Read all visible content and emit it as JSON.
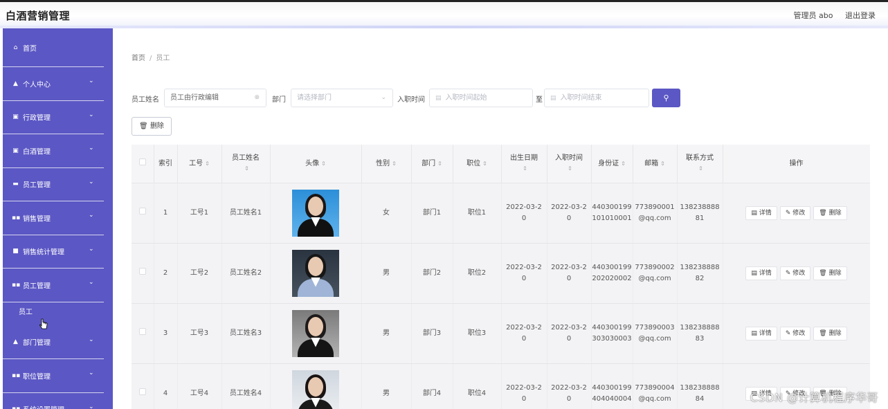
{
  "header": {
    "title": "白酒营销管理",
    "admin_label": "管理员 abo",
    "logout_label": "退出登录"
  },
  "sidebar": {
    "items": [
      {
        "label": "首页",
        "icon": "home-icon",
        "glyph": "⌂",
        "has_caret": false
      },
      {
        "label": "个人中心",
        "icon": "person-icon",
        "glyph": "▲",
        "has_caret": true
      },
      {
        "label": "行政管理",
        "icon": "building-icon",
        "glyph": "▣",
        "has_caret": true
      },
      {
        "label": "白酒管理",
        "icon": "bottle-icon",
        "glyph": "▣",
        "has_caret": true
      },
      {
        "label": "员工管理",
        "icon": "card-icon",
        "glyph": "▬",
        "has_caret": true
      },
      {
        "label": "销售管理",
        "icon": "grid-icon",
        "glyph": "▪▪",
        "has_caret": true
      },
      {
        "label": "销售统计管理",
        "icon": "square-icon",
        "glyph": "■",
        "has_caret": true
      },
      {
        "label": "员工管理",
        "icon": "grid-icon",
        "glyph": "▪▪",
        "has_caret": true
      },
      {
        "label": "部门管理",
        "icon": "person-icon",
        "glyph": "▲",
        "has_caret": true
      },
      {
        "label": "职位管理",
        "icon": "grid-icon",
        "glyph": "▪▪",
        "has_caret": true
      },
      {
        "label": "系统设置管理",
        "icon": "grid-icon",
        "glyph": "▪▪",
        "has_caret": true
      }
    ],
    "sub_item": "员工"
  },
  "breadcrumb": {
    "home": "首页",
    "sep": "/",
    "current": "员工"
  },
  "search": {
    "name_label": "员工姓名",
    "name_value": "员工由行政编辑",
    "dept_label": "部门",
    "dept_placeholder": "请选择部门",
    "date_label": "入职时间",
    "date_start_placeholder": "入职时间起始",
    "date_to": "至",
    "date_end_placeholder": "入职时间结束",
    "search_icon": "search-icon"
  },
  "toolbar": {
    "delete_label": "删除"
  },
  "table": {
    "columns": [
      "索引",
      "工号",
      "员工姓名",
      "头像",
      "性别",
      "部门",
      "职位",
      "出生日期",
      "入职时间",
      "身份证",
      "邮箱",
      "联系方式",
      "操作"
    ],
    "rows": [
      {
        "index": "1",
        "emp_no": "工号1",
        "name": "员工姓名1",
        "gender": "女",
        "dept": "部门1",
        "position": "职位1",
        "birth": "2022-03-2\n0",
        "hire": "2022-03-2\n0",
        "id_card": "440300199\n101010001",
        "email": "773890001\n@qq.com",
        "phone": "138238888\n81",
        "avatar_style": "female-blue"
      },
      {
        "index": "2",
        "emp_no": "工号2",
        "name": "员工姓名2",
        "gender": "男",
        "dept": "部门2",
        "position": "职位2",
        "birth": "2022-03-2\n0",
        "hire": "2022-03-2\n0",
        "id_card": "440300199\n202020002",
        "email": "773890002\n@qq.com",
        "phone": "138238888\n82",
        "avatar_style": "male-dark"
      },
      {
        "index": "3",
        "emp_no": "工号3",
        "name": "员工姓名3",
        "gender": "男",
        "dept": "部门3",
        "position": "职位3",
        "birth": "2022-03-2\n0",
        "hire": "2022-03-2\n0",
        "id_card": "440300199\n303030003",
        "email": "773890003\n@qq.com",
        "phone": "138238888\n83",
        "avatar_style": "female-gray"
      },
      {
        "index": "4",
        "emp_no": "工号4",
        "name": "员工姓名4",
        "gender": "男",
        "dept": "部门4",
        "position": "职位4",
        "birth": "2022-03-2\n0",
        "hire": "2022-03-2\n0",
        "id_card": "440300199\n404040004",
        "email": "773890004\n@qq.com",
        "phone": "138238888\n84",
        "avatar_style": "female-light"
      }
    ],
    "actions": {
      "detail": "详情",
      "edit": "修改",
      "delete": "删除"
    }
  },
  "watermark": "CSDN @计算机程序华哥",
  "colors": {
    "sidebar": "#5b57c4",
    "accent": "#5b57c4"
  }
}
